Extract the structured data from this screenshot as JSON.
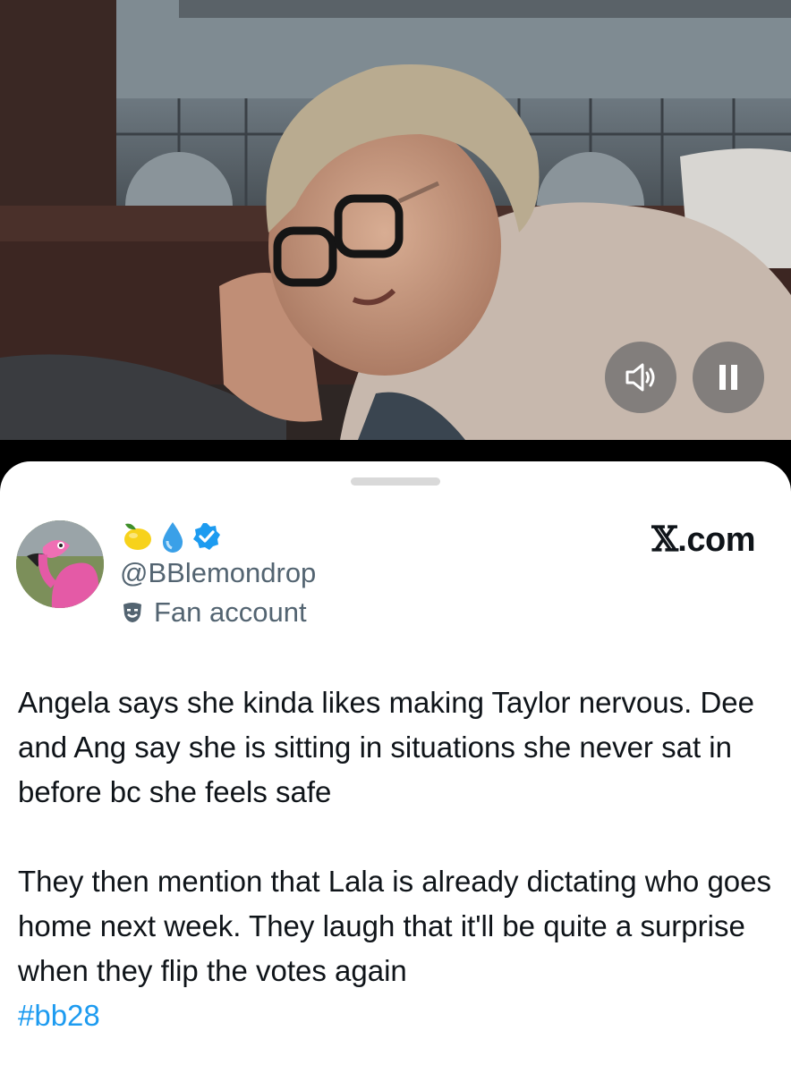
{
  "video": {
    "sound_icon": "speaker-icon",
    "pause_icon": "pause-icon"
  },
  "post": {
    "display_name_emojis": [
      "lemon-emoji",
      "droplet-emoji"
    ],
    "verified_icon": "verified-badge-icon",
    "handle": "@BBlemondrop",
    "account_label": "Fan account",
    "account_label_icon": "theater-masks-icon",
    "brand_x": "𝕏",
    "brand_domain": ".com",
    "paragraph1": "Angela says she kinda likes making Taylor nervous. Dee and Ang say she is sitting in situations she never sat in before bc she feels safe",
    "paragraph2": "They then mention that Lala is already dictating who goes home next week. They laugh that it'll be quite a surprise when they flip the votes again",
    "hashtag": "#bb28"
  },
  "colors": {
    "hashtag": "#1d9bf0",
    "secondary_text": "#536471",
    "verified": "#1d9bf0"
  }
}
